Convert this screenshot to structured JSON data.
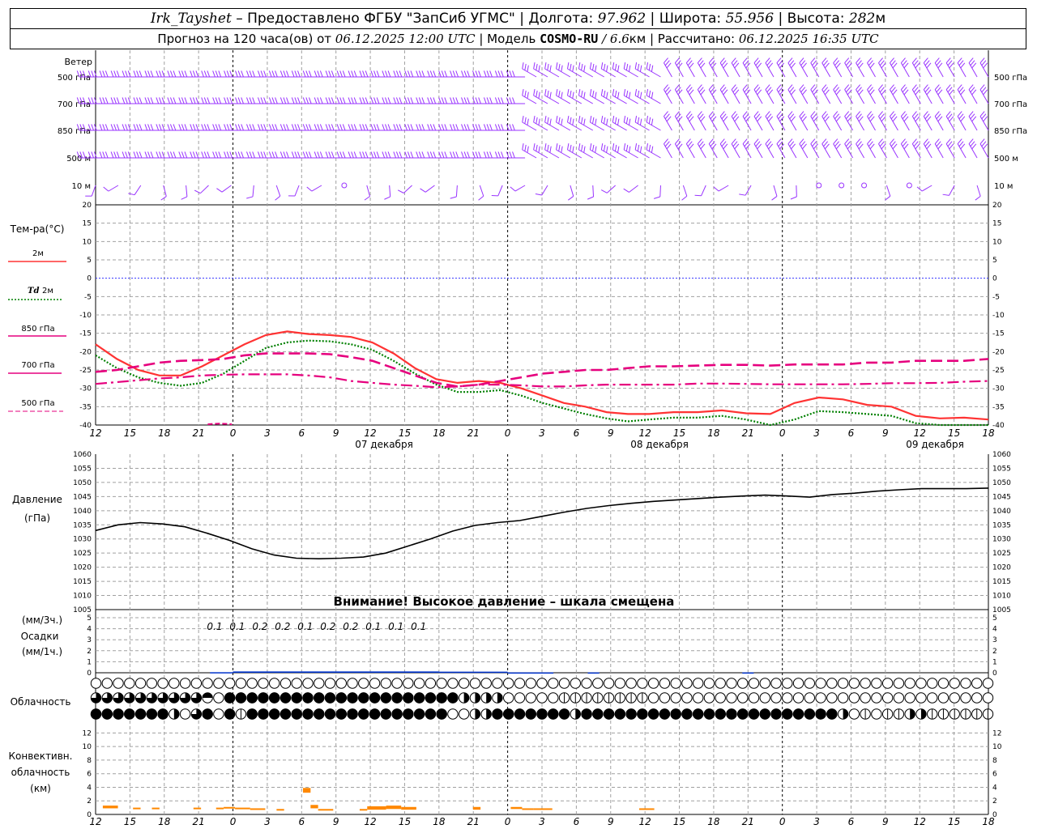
{
  "header": {
    "station": "Irk_Tayshet",
    "provider": " – Предоставлено ФГБУ \"ЗапСиб УГМС\" | Долгота: ",
    "lon": "97.962",
    "lat_label": " | Широта: ",
    "lat": "55.956",
    "alt_label": " | Высота: ",
    "alt": "282",
    "alt_unit": "м",
    "forecast_label": "Прогноз на 120 часа(ов) от ",
    "forecast_time": "06.12.2025 12:00 UTC",
    "model_label": " | Модель ",
    "model": "COSMO-RU",
    "model_res_sep": " / ",
    "model_res": "6.6",
    "model_res_unit": "км",
    "computed_label": " | Рассчитано: ",
    "computed_time": "06.12.2025 16:35 UTC"
  },
  "colors": {
    "wind": "#9933ff",
    "t2m": "#ff3333",
    "td2m": "#008000",
    "t850": "#e6007e",
    "t700": "#e6007e",
    "t500": "#e6007e",
    "zero_line": "#3333ff",
    "pressure": "#000000",
    "precip": "#0033cc",
    "convective": "#ff8800",
    "grid": "#a0a0a0"
  },
  "chart_data": [
    {
      "type": "wind-barbs",
      "title": "Ветер",
      "levels": [
        "500 гПа",
        "700 гПа",
        "850 гПа",
        "500 м",
        "10 м"
      ]
    },
    {
      "type": "line",
      "ylabel": "Тем-ра(°C)",
      "ylim": [
        -40,
        20
      ],
      "yticks": [
        20,
        15,
        10,
        5,
        0,
        -5,
        -10,
        -15,
        -20,
        -25,
        -30,
        -35,
        -40
      ],
      "x_hours": [
        0,
        3,
        6,
        9,
        12,
        15,
        18,
        21,
        24,
        27,
        30,
        33,
        36,
        39,
        42,
        45,
        48,
        51,
        54,
        57,
        60,
        63,
        66,
        69,
        72,
        75,
        78
      ],
      "series": [
        {
          "name": "2м",
          "style": "solid",
          "values": [
            -18,
            -22,
            -25,
            -26.5,
            -26.5,
            -24,
            -21,
            -18,
            -15.5,
            -14.5,
            -15.2,
            -15.5,
            -16,
            -17.5,
            -20.5,
            -24.5,
            -27.5,
            -28.5,
            -28,
            -28.5,
            -30,
            -32,
            -34,
            -35,
            -36.5,
            -37,
            -37
          ]
        },
        {
          "name": "Td 2м",
          "style": "dotted",
          "values": [
            -21,
            -24.5,
            -27,
            -28.5,
            -29.3,
            -28.5,
            -26,
            -22.5,
            -19,
            -17.5,
            -17,
            -17.2,
            -18,
            -19.5,
            -22.5,
            -26,
            -29,
            -31,
            -31,
            -30.5,
            -32,
            -34,
            -35.5,
            -37,
            -38.2,
            -39,
            -38.5
          ]
        },
        {
          "name": "850 гПа",
          "style": "dash",
          "values": [
            -25.5,
            -25,
            -24,
            -23,
            -22.5,
            -22.3,
            -22,
            -21,
            -20.5,
            -20.5,
            -20.5,
            -20.7,
            -21.5,
            -22.5,
            -24.5,
            -26.5,
            -28.5,
            -29.5,
            -29,
            -28,
            -27,
            -26,
            -25.5,
            -25,
            -25,
            -24.5,
            -24
          ]
        },
        {
          "name": "700 гПа",
          "style": "dashdot",
          "values": [
            -28.8,
            -28.3,
            -27.8,
            -27.3,
            -27,
            -26.5,
            -26.3,
            -26.2,
            -26.2,
            -26.2,
            -26.5,
            -27,
            -28,
            -28.5,
            -29,
            -29.3,
            -29.7,
            -29.5,
            -29,
            -29,
            -29.2,
            -29.5,
            -29.5,
            -29.2,
            -29,
            -29,
            -29
          ]
        }
      ],
      "series_500": {
        "name": "500 гПа",
        "style": "dash-short",
        "x_hours": [
          15.8,
          16.5,
          17.5,
          18.5,
          19.2
        ],
        "values": [
          -39.8,
          -39.7,
          -39.6,
          -39.7,
          -39.8
        ]
      },
      "t2m_tail": {
        "x_hours": [
          78,
          81,
          84,
          87,
          90,
          93,
          96,
          99,
          102,
          105,
          108,
          111,
          114,
          117,
          120
        ],
        "values": [
          -37,
          -36.5,
          -36.5,
          -36,
          -36.8,
          -37,
          -34,
          -32.5,
          -33,
          -34.5,
          -35,
          -37.5,
          -38.2,
          -38,
          -38.5
        ]
      },
      "td2m_tail": {
        "x_hours": [
          78,
          81,
          84,
          87,
          90,
          93,
          96,
          99,
          102,
          105,
          108,
          111,
          114,
          117,
          120
        ],
        "values": [
          -38.5,
          -38,
          -38,
          -37.5,
          -38.5,
          -41,
          -38.5,
          -36.2,
          -36.5,
          -37,
          -37.5,
          -39.5,
          -40.5,
          -40.5,
          -40.5
        ]
      },
      "t850_tail": {
        "x_hours": [
          78,
          81,
          84,
          87,
          90,
          93,
          96,
          99,
          102,
          105,
          108,
          111,
          114,
          117,
          120
        ],
        "values": [
          -24,
          -24,
          -23.8,
          -23.6,
          -23.6,
          -23.8,
          -23.5,
          -23.5,
          -23.5,
          -23,
          -23,
          -22.5,
          -22.5,
          -22.5,
          -22
        ]
      },
      "t700_tail": {
        "x_hours": [
          78,
          81,
          84,
          87,
          90,
          93,
          96,
          99,
          102,
          105,
          108,
          111,
          114,
          117,
          120
        ],
        "values": [
          -29,
          -29,
          -28.7,
          -28.7,
          -28.8,
          -28.9,
          -28.9,
          -28.9,
          -28.9,
          -28.8,
          -28.6,
          -28.6,
          -28.5,
          -28.2,
          -28
        ]
      }
    },
    {
      "type": "line",
      "ylabel": "Давление",
      "yunit": "(гПа)",
      "ylim": [
        1005,
        1060
      ],
      "yticks": [
        1060,
        1055,
        1050,
        1045,
        1040,
        1035,
        1030,
        1025,
        1020,
        1015,
        1010,
        1005
      ],
      "x_hours": [
        0,
        3,
        6,
        9,
        12,
        15,
        18,
        21,
        24,
        27,
        30,
        33,
        36,
        39,
        42,
        45,
        48,
        51,
        54,
        57,
        60,
        63,
        66,
        69,
        72,
        75,
        78,
        81,
        84,
        87,
        90,
        93,
        96,
        99,
        102,
        105,
        108,
        111,
        114,
        117,
        120
      ],
      "values": [
        1033,
        1035,
        1035.8,
        1035.3,
        1034.3,
        1032,
        1029.5,
        1026.5,
        1024.3,
        1023.2,
        1023,
        1023.2,
        1023.6,
        1025,
        1027.5,
        1030,
        1032.8,
        1034.8,
        1035.8,
        1036.5,
        1038,
        1039.5,
        1040.8,
        1041.8,
        1042.6,
        1043.3,
        1043.8,
        1044.3,
        1044.8,
        1045.2,
        1045.5,
        1045.2,
        1044.8,
        1045.7,
        1046.2,
        1046.9,
        1047.4,
        1047.8,
        1047.8,
        1047.8,
        1048
      ]
    },
    {
      "type": "bar",
      "ylabel_top": "(мм/3ч.)",
      "ylabel": "Осадки",
      "ylabel_bottom": "(мм/1ч.)",
      "ylim": [
        0,
        5
      ],
      "yticks": [
        5,
        4,
        3,
        2,
        1,
        0
      ],
      "labels": [
        {
          "hour": 15,
          "text": "0.1"
        },
        {
          "hour": 18,
          "text": "0.1"
        },
        {
          "hour": 21,
          "text": "0.2"
        },
        {
          "hour": 24,
          "text": "0.2"
        },
        {
          "hour": 27,
          "text": "0.1"
        },
        {
          "hour": 30,
          "text": "0.2"
        },
        {
          "hour": 33,
          "text": "0.2"
        },
        {
          "hour": 36,
          "text": "0.1"
        },
        {
          "hour": 39,
          "text": "0.1"
        },
        {
          "hour": 42,
          "text": "0.1"
        }
      ],
      "segments": [
        {
          "from": 10,
          "to": 12,
          "value": 0.05
        },
        {
          "from": 12,
          "to": 30,
          "value": 0.12
        },
        {
          "from": 30,
          "to": 36,
          "value": 0.1
        },
        {
          "from": 36,
          "to": 40,
          "value": 0.03
        },
        {
          "from": 43,
          "to": 44,
          "value": 0.03
        },
        {
          "from": 56.5,
          "to": 57.5,
          "value": 0.03
        }
      ]
    },
    {
      "type": "cloud-symbols",
      "ylabel": "Облачность",
      "rows": [
        "000000000000000000000000000000000000000000000000000000000000000000000000000000000",
        "333333333360444444444444444444444222200000111111110000000000000000000000000000000",
        "444444420340414444444444444444440022444444424444444444444444444444420101122111111"
      ]
    },
    {
      "type": "bar",
      "ylabel": "Конвективн.",
      "ylabel2": "облачность",
      "yunit": "(км)",
      "ylim": [
        0,
        13
      ],
      "yticks": [
        12,
        10,
        8,
        6,
        4,
        2,
        0
      ],
      "segments": [
        {
          "from": 0.5,
          "to": 2.5,
          "base": 0.9,
          "top": 1.3
        },
        {
          "from": 4.5,
          "to": 5.5,
          "base": 0.8,
          "top": 1.0
        },
        {
          "from": 7,
          "to": 8,
          "base": 0.8,
          "top": 1.0
        },
        {
          "from": 12.5,
          "to": 13.5,
          "base": 0.8,
          "top": 1.0
        },
        {
          "from": 15.5,
          "to": 16.5,
          "base": 0.8,
          "top": 1.0
        },
        {
          "from": 16.5,
          "to": 18,
          "base": 0.9,
          "top": 1.1
        },
        {
          "from": 18,
          "to": 20,
          "base": 0.8,
          "top": 1.0
        },
        {
          "from": 20,
          "to": 22,
          "base": 0.7,
          "top": 0.9
        },
        {
          "from": 23.5,
          "to": 24.5,
          "base": 0.6,
          "top": 0.8
        },
        {
          "from": 27,
          "to": 28,
          "base": 3.2,
          "top": 3.9
        },
        {
          "from": 28,
          "to": 29,
          "base": 0.9,
          "top": 1.4
        },
        {
          "from": 29,
          "to": 31,
          "base": 0.6,
          "top": 0.8
        },
        {
          "from": 34.5,
          "to": 35.5,
          "base": 0.6,
          "top": 0.8
        },
        {
          "from": 35.5,
          "to": 38,
          "base": 0.7,
          "top": 1.2
        },
        {
          "from": 38,
          "to": 40,
          "base": 0.8,
          "top": 1.3
        },
        {
          "from": 40,
          "to": 42,
          "base": 0.7,
          "top": 1.1
        },
        {
          "from": 49.5,
          "to": 50.5,
          "base": 0.7,
          "top": 1.1
        },
        {
          "from": 54.5,
          "to": 56,
          "base": 0.8,
          "top": 1.1
        },
        {
          "from": 56,
          "to": 57.5,
          "base": 0.7,
          "top": 0.9
        },
        {
          "from": 57.5,
          "to": 60,
          "base": 0.7,
          "top": 0.9
        },
        {
          "from": 71.5,
          "to": 73.5,
          "base": 0.7,
          "top": 0.9
        }
      ]
    }
  ],
  "labels": {
    "wind_title": "Ветер",
    "wind_levels": [
      "500 гПа",
      "700 гПа",
      "850 гПа",
      "500 м",
      "10 м"
    ],
    "temp_title": "Тем-ра(°C)",
    "legend_2m": "2м",
    "legend_td": "Td",
    "legend_td_suffix": " 2м",
    "legend_850": "850 гПа",
    "legend_700": "700 гПа",
    "legend_500": "500 гПа",
    "pressure_title": "Давление",
    "pressure_unit": "(гПа)",
    "pressure_warning": "Внимание! Высокое давление – шкала смещена",
    "precip_unit3": "(мм/3ч.)",
    "precip_title": "Осадки",
    "precip_unit1": "(мм/1ч.)",
    "cloud_title": "Облачность",
    "conv_title1": "Конвективн.",
    "conv_title2": "облачность",
    "conv_unit": "(км)",
    "hour_ticks": [
      "12",
      "15",
      "18",
      "21",
      "0",
      "3",
      "6",
      "9",
      "12",
      "15",
      "18",
      "21",
      "0",
      "3",
      "6",
      "9",
      "12",
      "15",
      "18",
      "21",
      "0",
      "3",
      "6",
      "9",
      "12",
      "15",
      "18"
    ],
    "dates": [
      {
        "hour": 30,
        "text": "07 декабря"
      },
      {
        "hour": 54,
        "text": "08 декабря"
      },
      {
        "hour": 78,
        "text": "09 декабря"
      }
    ]
  }
}
